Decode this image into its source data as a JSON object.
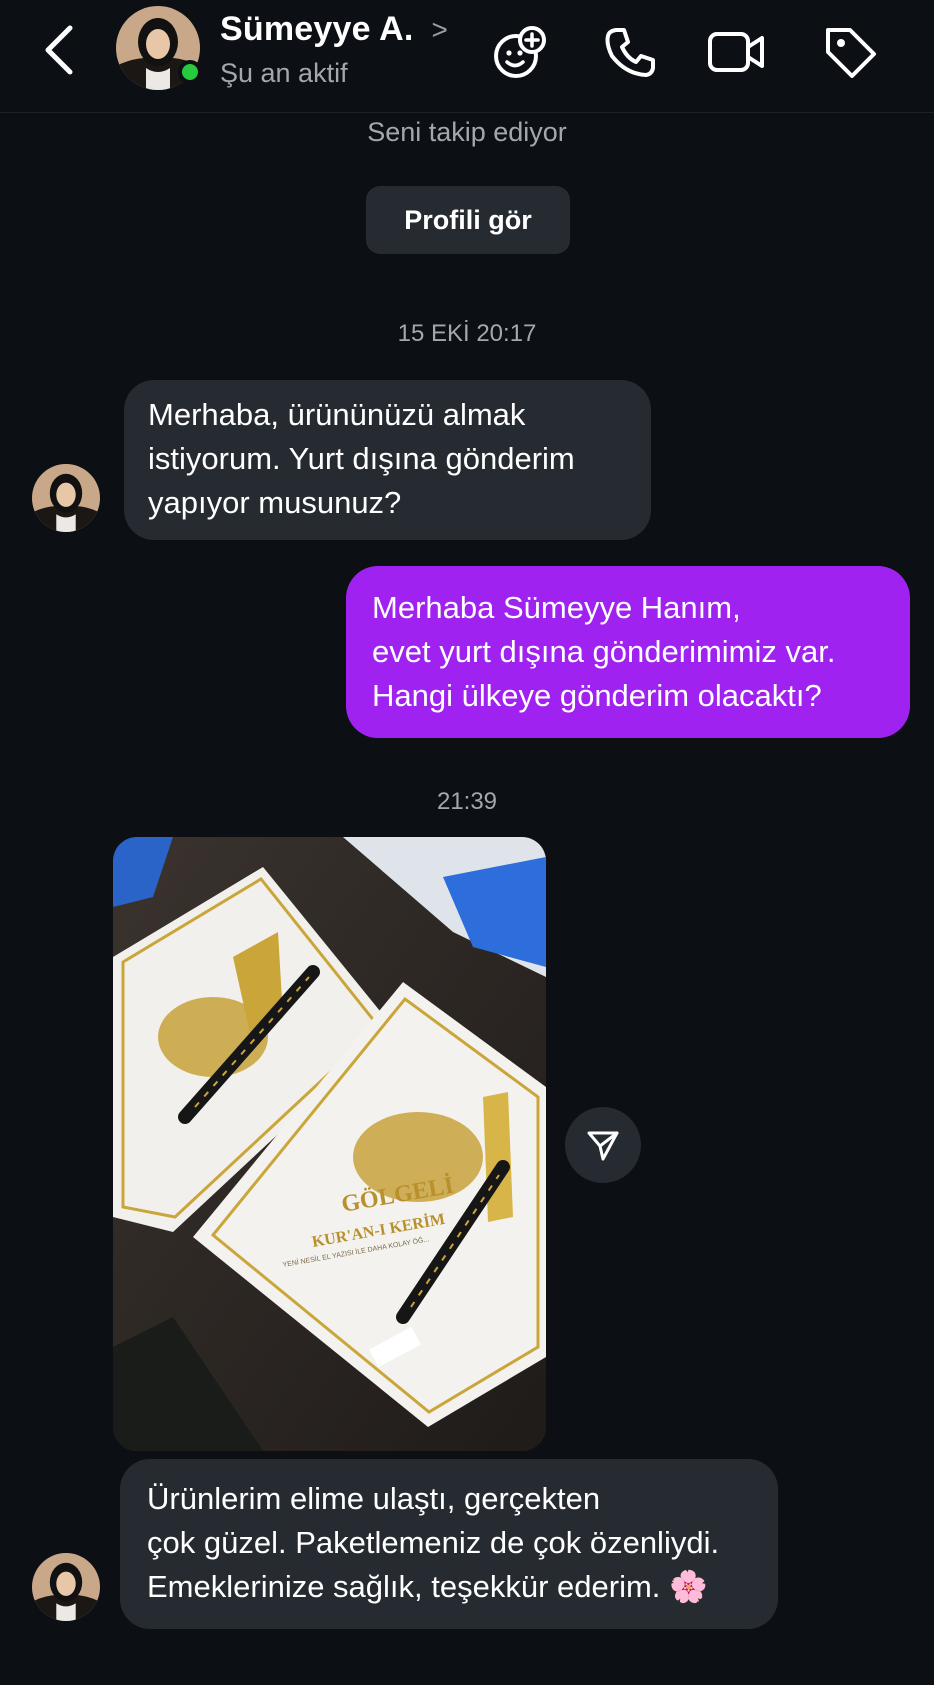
{
  "header": {
    "contact_name": "Sümeyye A.",
    "name_chevron": ">",
    "status": "Şu an aktif",
    "online": true,
    "icons": [
      "back-icon",
      "add-person-icon",
      "phone-icon",
      "video-icon",
      "tag-icon"
    ]
  },
  "intro": {
    "follow_note": "Seni takip ediyor",
    "profile_button": "Profili gör"
  },
  "messages": [
    {
      "timestamp": "15 EKİ 20:17",
      "direction": "incoming",
      "lines": [
        "Merhaba, ürününüzü almak",
        "istiyorum. Yurt dışına gönderim",
        "yapıyor musunuz?"
      ]
    },
    {
      "direction": "outgoing",
      "lines": [
        "Merhaba Sümeyye Hanım,",
        "evet yurt dışına gönderimimiz var.",
        "Hangi ülkeye gönderim olacaktı?"
      ]
    },
    {
      "timestamp": "21:39",
      "direction": "incoming",
      "type": "photo",
      "photo_text": [
        "GÖLGELİ",
        "KUR'AN-I KERİM",
        "YENİ NESİL EL YAZISI İLE DAHA KOLAY ÖĞ..."
      ]
    },
    {
      "direction": "incoming",
      "lines": [
        "Ürünlerim elime ulaştı, gerçekten",
        "çok güzel. Paketlemeniz de çok özenliydi.",
        "Emeklerinize sağlık, teşekkür ederim."
      ],
      "emoji": "🌸"
    }
  ],
  "colors": {
    "background": "#0c0f14",
    "incoming_bubble": "#262a31",
    "outgoing_bubble": "#a022f0",
    "online": "#27c93f",
    "secondary_text": "#a3a8b0"
  }
}
